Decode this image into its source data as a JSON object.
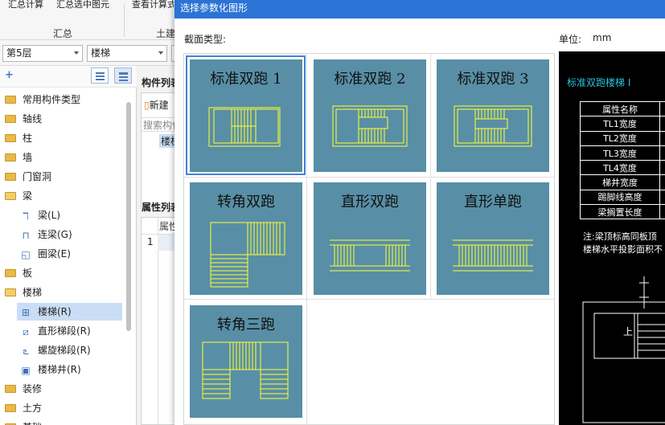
{
  "ribbon": {
    "buttons": [
      "汇总计算",
      "汇总选中图元",
      "查看计算式"
    ],
    "groups": [
      "汇总",
      "土建"
    ]
  },
  "toolbar": {
    "floor_select": "第5层",
    "category_select": "楼梯"
  },
  "tree": {
    "items": [
      {
        "label": "常用构件类型",
        "type": "folder",
        "expanded": false
      },
      {
        "label": "轴线",
        "type": "folder",
        "expanded": false
      },
      {
        "label": "柱",
        "type": "folder",
        "expanded": false
      },
      {
        "label": "墙",
        "type": "folder",
        "expanded": false
      },
      {
        "label": "门窗洞",
        "type": "folder",
        "expanded": false
      },
      {
        "label": "梁",
        "type": "folder",
        "expanded": true
      },
      {
        "label": "梁(L)",
        "type": "beam-icon"
      },
      {
        "label": "连梁(G)",
        "type": "link-beam-icon"
      },
      {
        "label": "圈梁(E)",
        "type": "ring-beam-icon"
      },
      {
        "label": "板",
        "type": "folder",
        "expanded": false
      },
      {
        "label": "楼梯",
        "type": "folder",
        "expanded": true
      },
      {
        "label": "楼梯(R)",
        "type": "stair-icon",
        "selected": true
      },
      {
        "label": "直形梯段(R)",
        "type": "straight-flight-icon"
      },
      {
        "label": "螺旋梯段(R)",
        "type": "spiral-flight-icon"
      },
      {
        "label": "楼梯井(R)",
        "type": "stairwell-icon"
      },
      {
        "label": "装修",
        "type": "folder",
        "expanded": false
      },
      {
        "label": "土方",
        "type": "folder",
        "expanded": false
      },
      {
        "label": "基础",
        "type": "folder",
        "expanded": false
      }
    ]
  },
  "middle": {
    "list_header": "构件列表",
    "new_button": "新建",
    "search_placeholder": "搜索构件",
    "list_item": "楼梯",
    "props_header": "属性列表",
    "col_header": "属性名称",
    "row_number": "1"
  },
  "dialog": {
    "title": "选择参数化图形",
    "section_label": "截面类型:",
    "unit_label": "单位:",
    "unit_value": "mm",
    "tiles": [
      {
        "label": "标准双跑 1",
        "selected": true
      },
      {
        "label": "标准双跑 2",
        "selected": false
      },
      {
        "label": "标准双跑 3",
        "selected": false
      },
      {
        "label": "转角双跑",
        "selected": false
      },
      {
        "label": "直形双跑",
        "selected": false
      },
      {
        "label": "直形单跑",
        "selected": false
      },
      {
        "label": "转角三跑",
        "selected": false
      }
    ]
  },
  "preview": {
    "title": "标准双跑楼梯 I",
    "properties": [
      "属性名称",
      "TL1宽度",
      "TL2宽度",
      "TL3宽度",
      "TL4宽度",
      "梯井宽度",
      "踢脚线高度",
      "梁搁置长度"
    ],
    "note_lines": [
      "注:梁顶标高同板顶",
      "楼梯水平投影面积不"
    ],
    "plan_label": "上"
  },
  "colors": {
    "title_bar": "#2b73d4",
    "tile_bg": "#588fa6",
    "tile_line": "#ffff33",
    "preview_bg": "#000000",
    "preview_title": "#27c4e0",
    "selection": "#3f83d6"
  }
}
